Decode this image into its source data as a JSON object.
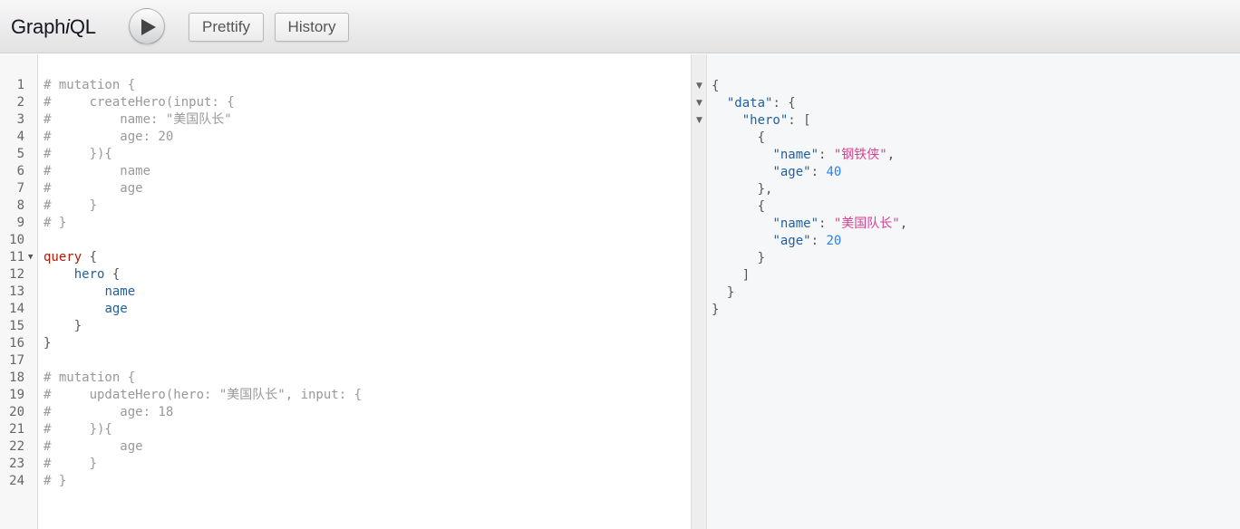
{
  "app": {
    "title_prefix": "Graph",
    "title_italic": "i",
    "title_suffix": "QL"
  },
  "toolbar": {
    "execute_icon": "play-icon",
    "prettify_label": "Prettify",
    "history_label": "History"
  },
  "editor": {
    "lines": [
      {
        "n": "1",
        "text": "# mutation {"
      },
      {
        "n": "2",
        "text": "#     createHero(input: {"
      },
      {
        "n": "3",
        "text": "#         name: \"美国队长\""
      },
      {
        "n": "4",
        "text": "#         age: 20"
      },
      {
        "n": "5",
        "text": "#     }){"
      },
      {
        "n": "6",
        "text": "#         name"
      },
      {
        "n": "7",
        "text": "#         age"
      },
      {
        "n": "8",
        "text": "#     }"
      },
      {
        "n": "9",
        "text": "# }"
      },
      {
        "n": "10",
        "text": ""
      },
      {
        "n": "11",
        "text": "query {"
      },
      {
        "n": "12",
        "text": "    hero {"
      },
      {
        "n": "13",
        "text": "        name"
      },
      {
        "n": "14",
        "text": "        age"
      },
      {
        "n": "15",
        "text": "    }"
      },
      {
        "n": "16",
        "text": "}"
      },
      {
        "n": "17",
        "text": ""
      },
      {
        "n": "18",
        "text": "# mutation {"
      },
      {
        "n": "19",
        "text": "#     updateHero(hero: \"美国队长\", input: {"
      },
      {
        "n": "20",
        "text": "#         age: 18"
      },
      {
        "n": "21",
        "text": "#     }){"
      },
      {
        "n": "22",
        "text": "#         age"
      },
      {
        "n": "23",
        "text": "#     }"
      },
      {
        "n": "24",
        "text": "# }"
      }
    ],
    "query_keyword": "query",
    "query_field": "hero",
    "query_subfields": [
      "name",
      "age"
    ],
    "open_brace": "{",
    "close_brace": "}"
  },
  "result": {
    "open_brace": "{",
    "close_brace": "}",
    "data_key": "\"data\"",
    "hero_key": "\"hero\"",
    "open_bracket": "[",
    "close_bracket": "]",
    "items": [
      {
        "name_key": "\"name\"",
        "name_value": "\"钢铁侠\"",
        "age_key": "\"age\"",
        "age_value": "40"
      },
      {
        "name_key": "\"name\"",
        "name_value": "\"美国队长\"",
        "age_key": "\"age\"",
        "age_value": "20"
      }
    ]
  },
  "colors": {
    "comment": "#999999",
    "keyword": "#b11a04",
    "field": "#1f61a0",
    "string": "#d64292",
    "number": "#2882f9"
  }
}
